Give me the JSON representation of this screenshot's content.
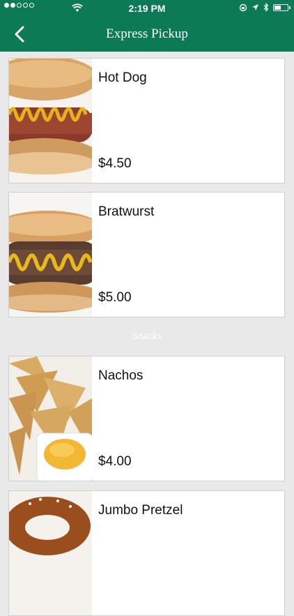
{
  "status_bar": {
    "time": "2:19 PM",
    "signal_icon": "signal-dots-icon",
    "wifi_icon": "wifi-icon",
    "location_icon": "location-arrow-icon",
    "bluetooth_icon": "bluetooth-icon",
    "battery_icon": "battery-icon"
  },
  "nav": {
    "title": "Express Pickup",
    "back_icon": "chevron-left-icon"
  },
  "colors": {
    "brand": "#0b7a55",
    "background": "#e9e9e9"
  },
  "items": [
    {
      "name": "Hot Dog",
      "price": "$4.50",
      "image": "hot-dog-image"
    },
    {
      "name": "Bratwurst",
      "price": "$5.00",
      "image": "bratwurst-image"
    }
  ],
  "sections": [
    {
      "title": "Snacks",
      "items": [
        {
          "name": "Nachos",
          "price": "$4.00",
          "image": "nachos-image"
        },
        {
          "name": "Jumbo Pretzel",
          "price": "",
          "image": "pretzel-image"
        }
      ]
    }
  ]
}
